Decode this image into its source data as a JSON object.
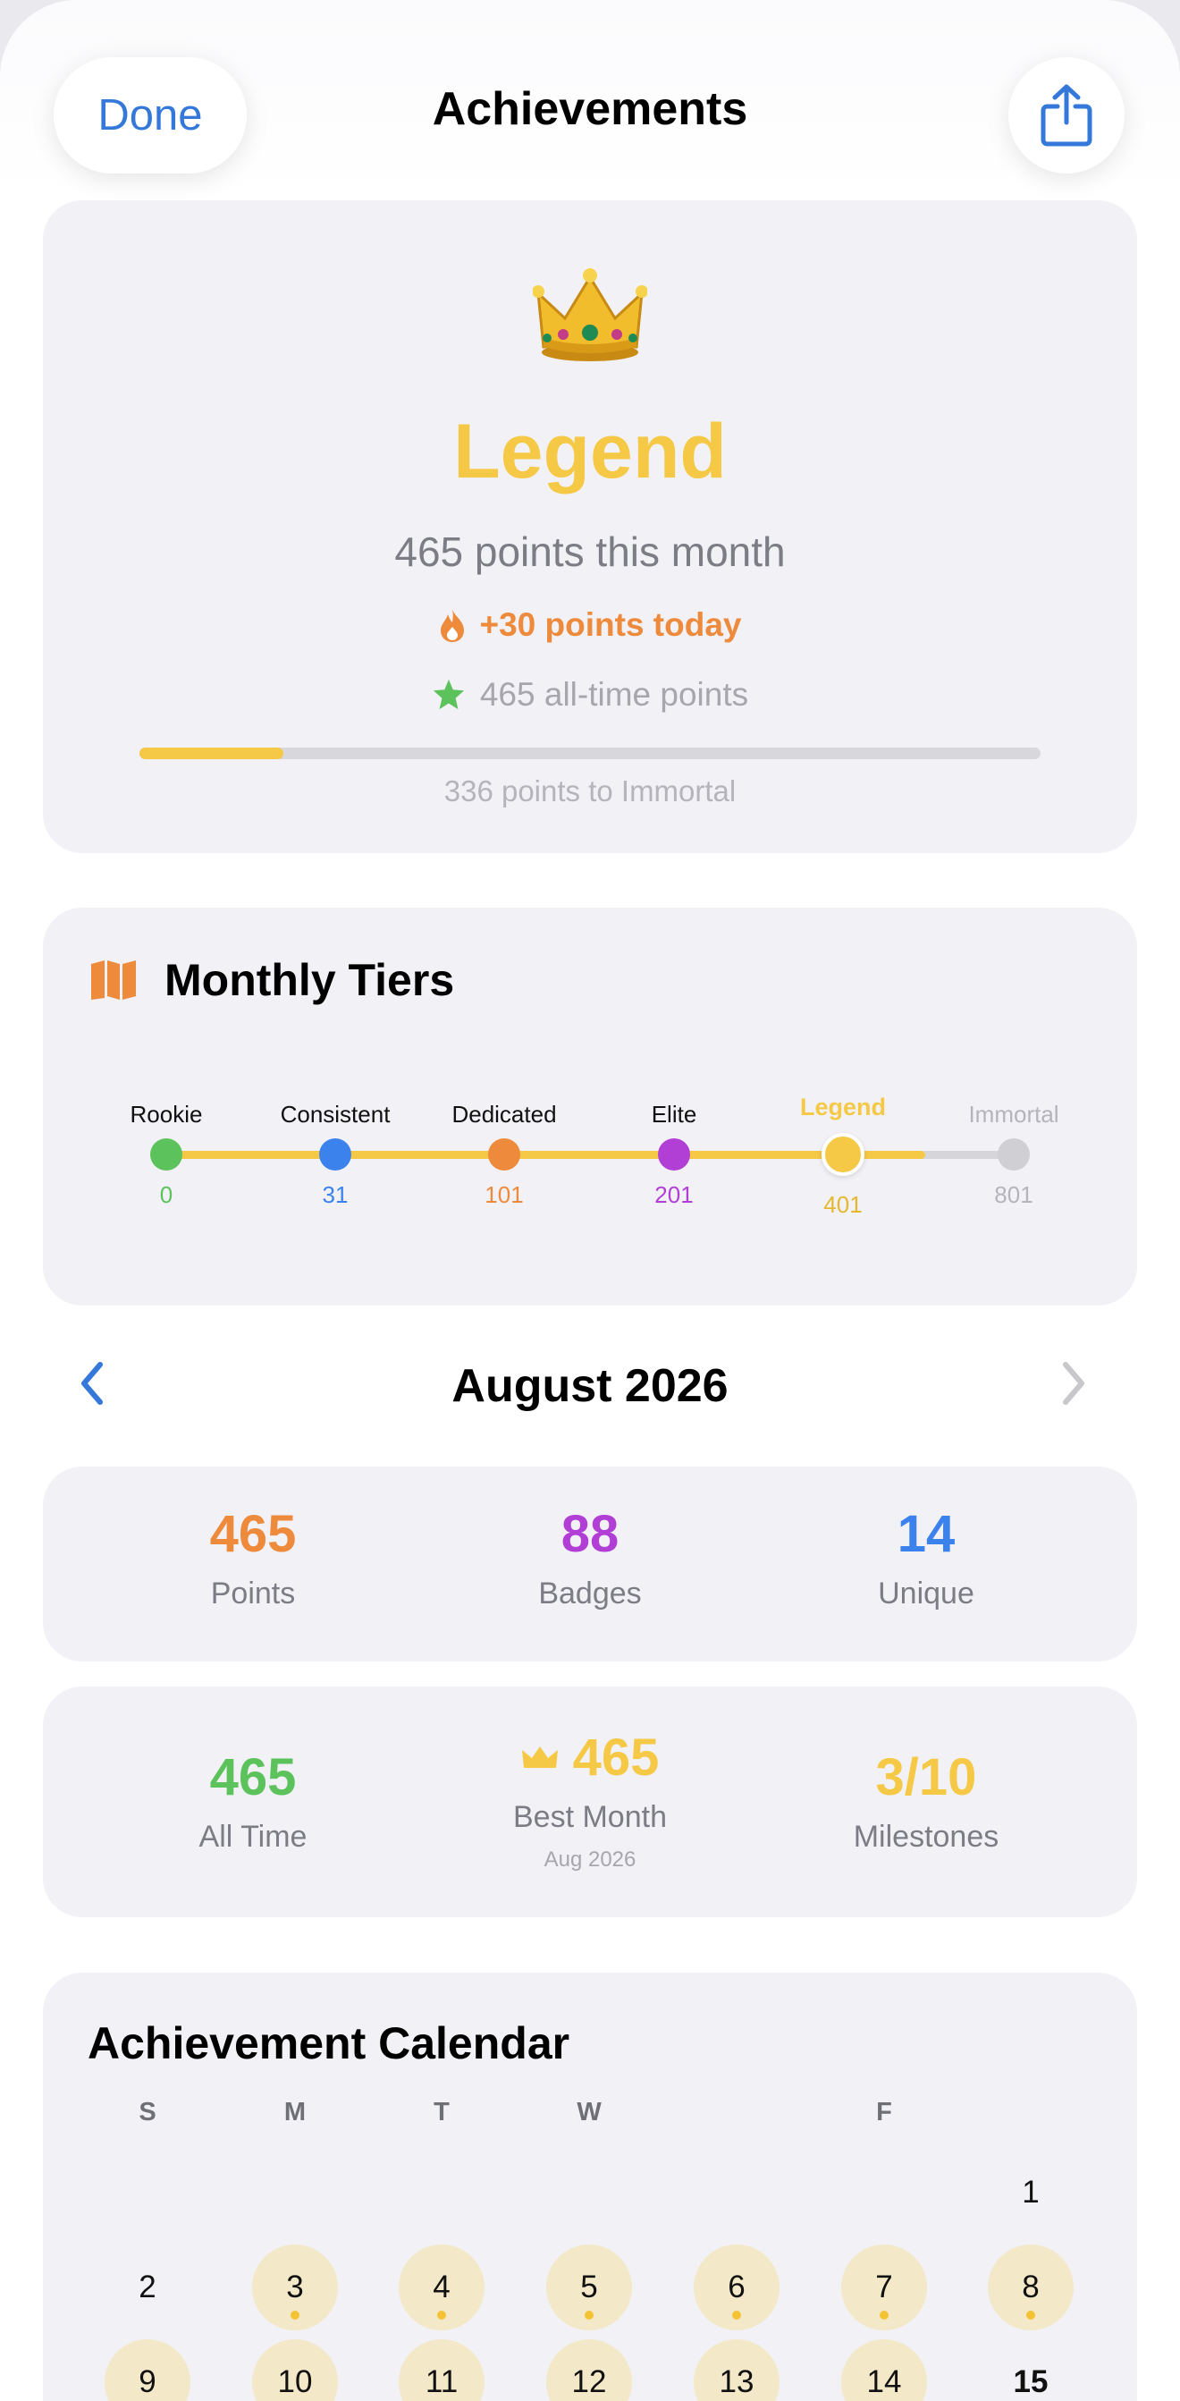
{
  "header": {
    "done_label": "Done",
    "title": "Achievements",
    "share_icon": "share-icon"
  },
  "level": {
    "icon": "crown-icon",
    "name": "Legend",
    "month_points_text": "465 points this month",
    "today_text": "+30 points today",
    "alltime_text": "465 all-time points",
    "progress_fraction": 0.16,
    "to_next_text": "336 points to Immortal",
    "colors": {
      "accent": "#f5c945",
      "today": "#ee8a3c",
      "star": "#5cc25b"
    }
  },
  "tiers": {
    "title": "Monthly Tiers",
    "icon": "map-icon",
    "items": [
      {
        "name": "Rookie",
        "points": "0",
        "color": "#5cc25b"
      },
      {
        "name": "Consistent",
        "points": "31",
        "color": "#3c82ed"
      },
      {
        "name": "Dedicated",
        "points": "101",
        "color": "#ee8a3c"
      },
      {
        "name": "Elite",
        "points": "201",
        "color": "#b13fd6"
      },
      {
        "name": "Legend",
        "points": "401",
        "color": "#f5c945",
        "current": true
      },
      {
        "name": "Immortal",
        "points": "801",
        "color": "#cfcfd4",
        "locked": true
      }
    ]
  },
  "month_nav": {
    "label": "August 2026",
    "prev_icon": "chevron-left-icon",
    "next_icon": "chevron-right-icon"
  },
  "stats_row1": [
    {
      "value": "465",
      "label": "Points",
      "color": "#ee8a3c"
    },
    {
      "value": "88",
      "label": "Badges",
      "color": "#b13fd6"
    },
    {
      "value": "14",
      "label": "Unique",
      "color": "#3c82ed"
    }
  ],
  "stats_row2": [
    {
      "value": "465",
      "label": "All Time",
      "color": "#5cc25b"
    },
    {
      "value": "465",
      "label": "Best Month",
      "sub": "Aug 2026",
      "color": "#f5c945",
      "icon": "crown-icon"
    },
    {
      "value": "3/10",
      "label": "Milestones",
      "color": "#f5c945"
    }
  ],
  "calendar": {
    "title": "Achievement Calendar",
    "weekdays": [
      "S",
      "M",
      "T",
      "W",
      "",
      "F",
      ""
    ],
    "days": [
      {
        "day": "1",
        "earned": false
      },
      {
        "day": "2",
        "earned": false
      },
      {
        "day": "3",
        "earned": true
      },
      {
        "day": "4",
        "earned": true
      },
      {
        "day": "5",
        "earned": true
      },
      {
        "day": "6",
        "earned": true
      },
      {
        "day": "7",
        "earned": true
      },
      {
        "day": "8",
        "earned": true
      },
      {
        "day": "9",
        "earned": true
      },
      {
        "day": "10",
        "earned": true
      },
      {
        "day": "11",
        "earned": true
      },
      {
        "day": "12",
        "earned": true
      },
      {
        "day": "13",
        "earned": true
      },
      {
        "day": "14",
        "earned": true
      },
      {
        "day": "15",
        "earned": false,
        "today": true
      }
    ]
  }
}
